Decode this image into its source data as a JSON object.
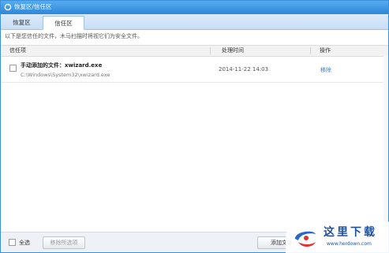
{
  "window": {
    "title": "恢复区/信任区"
  },
  "tabs": [
    {
      "label": "恢复区"
    },
    {
      "label": "信任区"
    }
  ],
  "notice": "以下是您信任的文件，木马扫描时将视它们为安全文件。",
  "table": {
    "headers": [
      "信任项",
      "处理时间",
      "操作"
    ],
    "rows": [
      {
        "name": "手动添加的文件：xwizard.exe",
        "path": "C:\\Windows\\System32\\xwizard.exe",
        "time": "2014-11-22 14:03",
        "action": "移除"
      }
    ]
  },
  "footer": {
    "select_all": "全选",
    "remove_selected": "移除所选项",
    "add_file": "添加文件"
  },
  "watermark": {
    "text": "这里下载",
    "url": "www.herdown.com"
  },
  "colors": {
    "accent": "#2f87d9",
    "link": "#2f7fd3"
  }
}
